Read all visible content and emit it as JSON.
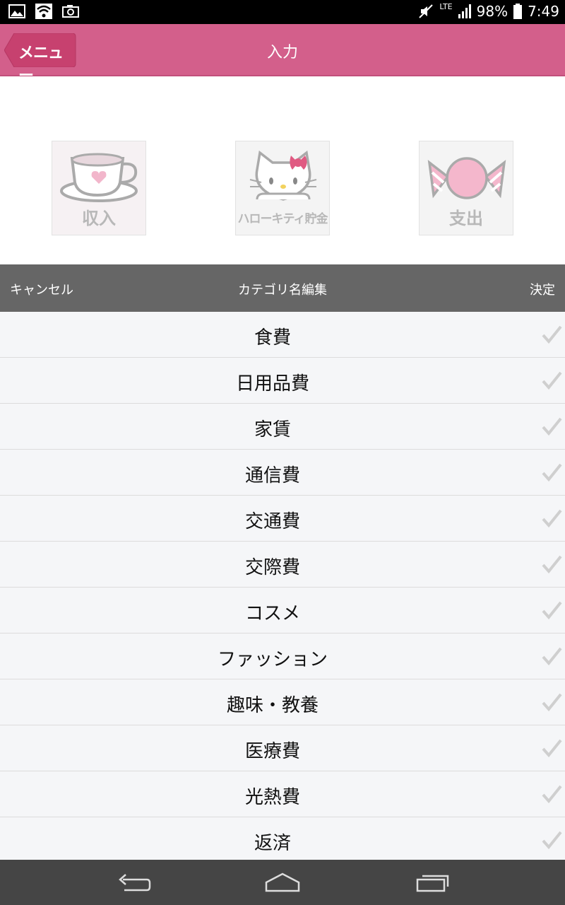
{
  "status_bar": {
    "battery_percent": "98%",
    "time": "7:49",
    "network": "LTE",
    "left_icons": [
      "image-icon",
      "wifi-icon",
      "camera-icon"
    ]
  },
  "app_bar": {
    "back_label": "メニュー",
    "title": "入力",
    "color": "#d35f8b"
  },
  "category_buttons": [
    {
      "label": "収入",
      "icon": "teacup-icon"
    },
    {
      "label": "ハローキティ貯金",
      "icon": "kitty-icon"
    },
    {
      "label": "支出",
      "icon": "candy-icon"
    }
  ],
  "edit_bar": {
    "cancel_label": "キャンセル",
    "title": "カテゴリ名編集",
    "done_label": "決定"
  },
  "categories": [
    {
      "name": "食費"
    },
    {
      "name": "日用品費"
    },
    {
      "name": "家賃"
    },
    {
      "name": "通信費"
    },
    {
      "name": "交通費"
    },
    {
      "name": "交際費"
    },
    {
      "name": "コスメ"
    },
    {
      "name": "ファッション"
    },
    {
      "name": "趣味・教養"
    },
    {
      "name": "医療費"
    },
    {
      "name": "光熱費"
    },
    {
      "name": "返済"
    }
  ],
  "nav_bar": {
    "buttons": [
      "back-nav-icon",
      "home-nav-icon",
      "recents-nav-icon"
    ]
  }
}
